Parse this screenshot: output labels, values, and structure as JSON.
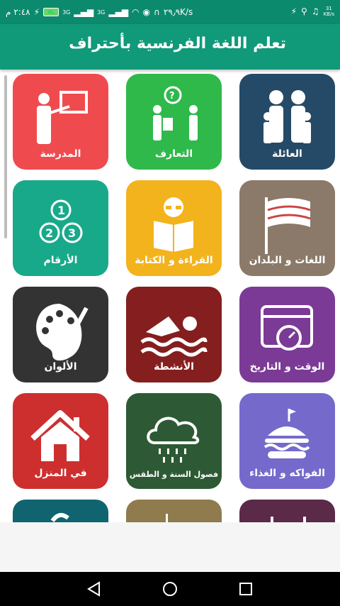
{
  "status_bar": {
    "time": "٢:٤٨ م",
    "battery": "AL",
    "signal_a": "3G",
    "signal_b": "3G",
    "net_speed": "٢٩٫٩K/s",
    "data_rate_value": "31",
    "data_rate_unit": "KB/s"
  },
  "app_bar": {
    "title": "تعلم اللغة الفرنسية بأحتراف"
  },
  "tiles": [
    {
      "label": "العائلة",
      "color": "#254a67",
      "icon": "family-icon"
    },
    {
      "label": "التعارف",
      "color": "#2fb94b",
      "icon": "meeting-icon"
    },
    {
      "label": "المدرسة",
      "color": "#ef4b4f",
      "icon": "teacher-icon"
    },
    {
      "label": "اللغات و البلدان",
      "color": "#8b7a69",
      "icon": "flag-icon"
    },
    {
      "label": "القراءة و الكتابة",
      "color": "#f3b31d",
      "icon": "reading-icon"
    },
    {
      "label": "الأرقام",
      "color": "#18a98a",
      "icon": "numbers-icon"
    },
    {
      "label": "الوقت و التاريخ",
      "color": "#7b3a95",
      "icon": "calendar-icon"
    },
    {
      "label": "الأنشطة",
      "color": "#851e1e",
      "icon": "swimming-icon"
    },
    {
      "label": "الألوان",
      "color": "#333333",
      "icon": "palette-icon"
    },
    {
      "label": "الفواكه و الغذاء",
      "color": "#7669cc",
      "icon": "burger-icon"
    },
    {
      "label": "فصول السنة و الطقس",
      "color": "#2d5a34",
      "icon": "rain-cloud-icon"
    },
    {
      "label": "في المنزل",
      "color": "#cd2f2f",
      "icon": "house-icon"
    },
    {
      "label": "",
      "color": "#5a2a48",
      "icon": "partial-icon"
    },
    {
      "label": "",
      "color": "#8f7b4d",
      "icon": "partial-icon"
    },
    {
      "label": "",
      "color": "#0f6470",
      "icon": "partial-icon"
    }
  ],
  "nav": {
    "back": "back-icon",
    "home": "home-icon",
    "recents": "recents-icon"
  }
}
